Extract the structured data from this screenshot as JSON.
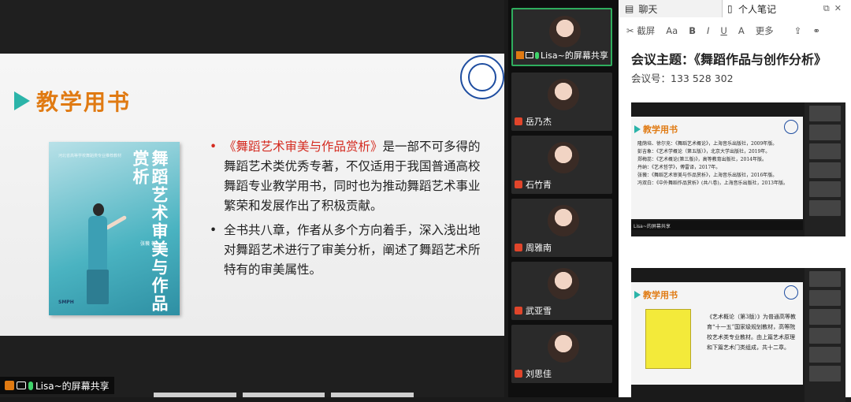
{
  "share": {
    "slide_title": "教学用书",
    "book": {
      "title": "舞蹈艺术审美与作品赏析",
      "small_text": "河北省高等学校舞蹈类专业推荐教材",
      "author": "张薇 著"
    },
    "bullets": [
      {
        "prefix": "《舞蹈艺术审美与作品赏析》",
        "text": "是一部不可多得的舞蹈艺术类优秀专著，不仅适用于我国普通高校舞蹈专业教学用书，同时也为推动舞蹈艺术事业繁荣和发展作出了积极贡献。"
      },
      {
        "prefix": "",
        "text": "全书共八章，作者从多个方向着手，深入浅出地对舞蹈艺术进行了审美分析，阐述了舞蹈艺术所特有的审美属性。"
      }
    ],
    "sharer_label": "Lisa~的屏幕共享"
  },
  "participants": [
    {
      "name": "Lisa~的屏幕共享",
      "active": true
    },
    {
      "name": "岳乃杰"
    },
    {
      "name": "石竹青"
    },
    {
      "name": "周雅南"
    },
    {
      "name": "武亚雪"
    },
    {
      "name": "刘思佳"
    }
  ],
  "tabs": {
    "chat": "聊天",
    "notes": "个人笔记"
  },
  "toolbar": [
    "截屏",
    "Aa",
    "B",
    "I",
    "U",
    "A",
    "更多"
  ],
  "notes": {
    "title": "会议主题：《舞蹈作品与创作分析》",
    "meeting_id": "会议号：133 528 302",
    "shot1": {
      "title": "教学用书",
      "lines": [
        "隆荫培、徐尔充：《舞蹈艺术概论》，上海音乐出版社，2009年版。",
        "彭吉象：《艺术学概论（第五版）》，北京大学出版社，2019年。",
        "郑梅蕊：《艺术概论(第三版)》，高等教育出版社，2014年版。",
        "丹纳：《艺术哲学》，傅雷译，2017年。",
        "张薇：《舞蹈艺术审美与作品赏析》，上海音乐出版社，2016年版。",
        "冯双白：《中外舞蹈作品赏析》(共八卷)，上海音乐出版社，2013年版。"
      ],
      "bar": "Lisa~的屏幕共享"
    },
    "shot2": {
      "title": "教学用书",
      "text": "《艺术概论（第3版）》为普通高等教育“十一五”国家级规划教材，高等院校艺术类专业教材。由上篇艺术原理和下篇艺术门类组成，共十二章。"
    }
  }
}
